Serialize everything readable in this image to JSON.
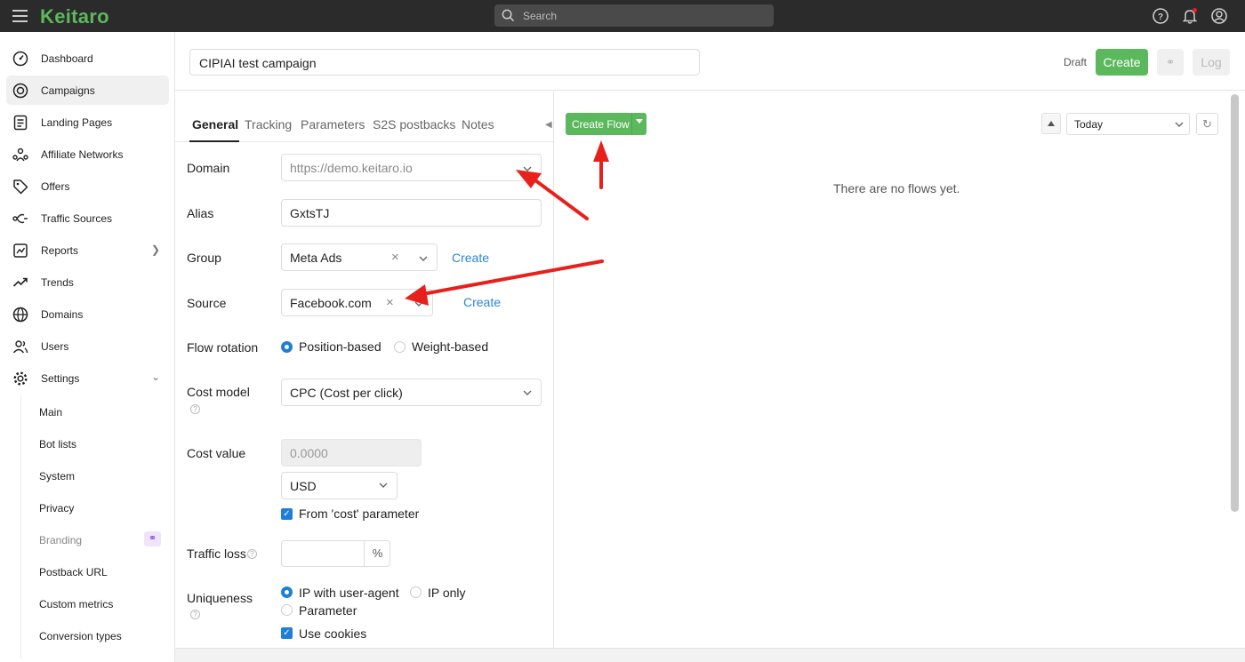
{
  "topbar": {
    "logo": "Keitaro",
    "search_placeholder": "Search"
  },
  "sidebar": {
    "items": [
      {
        "label": "Dashboard",
        "icon": "dashboard-icon"
      },
      {
        "label": "Campaigns",
        "icon": "campaigns-icon",
        "active": true
      },
      {
        "label": "Landing Pages",
        "icon": "landing-pages-icon"
      },
      {
        "label": "Affiliate Networks",
        "icon": "affiliate-networks-icon"
      },
      {
        "label": "Offers",
        "icon": "offers-icon"
      },
      {
        "label": "Traffic Sources",
        "icon": "traffic-sources-icon"
      },
      {
        "label": "Reports",
        "icon": "reports-icon"
      },
      {
        "label": "Trends",
        "icon": "trends-icon"
      },
      {
        "label": "Domains",
        "icon": "domains-icon"
      },
      {
        "label": "Users",
        "icon": "users-icon"
      },
      {
        "label": "Settings",
        "icon": "settings-icon"
      }
    ],
    "settings_sub": [
      "Main",
      "Bot lists",
      "System",
      "Privacy",
      "Branding",
      "Postback URL",
      "Custom metrics",
      "Conversion types"
    ]
  },
  "header": {
    "campaign_name": "CIPIAI test campaign",
    "status": "Draft",
    "create_label": "Create",
    "log_label": "Log"
  },
  "tabs": [
    "General",
    "Tracking",
    "Parameters",
    "S2S postbacks",
    "Notes"
  ],
  "form": {
    "domain_label": "Domain",
    "domain_value": "https://demo.keitaro.io",
    "alias_label": "Alias",
    "alias_value": "GxtsTJ",
    "group_label": "Group",
    "group_value": "Meta Ads",
    "group_create": "Create",
    "source_label": "Source",
    "source_value": "Facebook.com",
    "source_create": "Create",
    "flow_rotation_label": "Flow rotation",
    "flow_rotation_options": [
      "Position-based",
      "Weight-based"
    ],
    "cost_model_label": "Cost model",
    "cost_model_value": "CPC (Cost per click)",
    "cost_value_label": "Cost value",
    "cost_value_placeholder": "0.0000",
    "currency_value": "USD",
    "cost_param_label": "From 'cost' parameter",
    "traffic_loss_label": "Traffic loss",
    "traffic_loss_unit": "%",
    "uniqueness_label": "Uniqueness",
    "uniqueness_options": [
      "IP with user-agent",
      "IP only",
      "Parameter"
    ],
    "use_cookies_label": "Use cookies"
  },
  "flows": {
    "create_flow_label": "Create Flow",
    "period_value": "Today",
    "empty_text": "There are no flows yet."
  },
  "colors": {
    "brand_green": "#5cb85c",
    "link_blue": "#2b86d4",
    "annotation_red": "#e8201c"
  }
}
